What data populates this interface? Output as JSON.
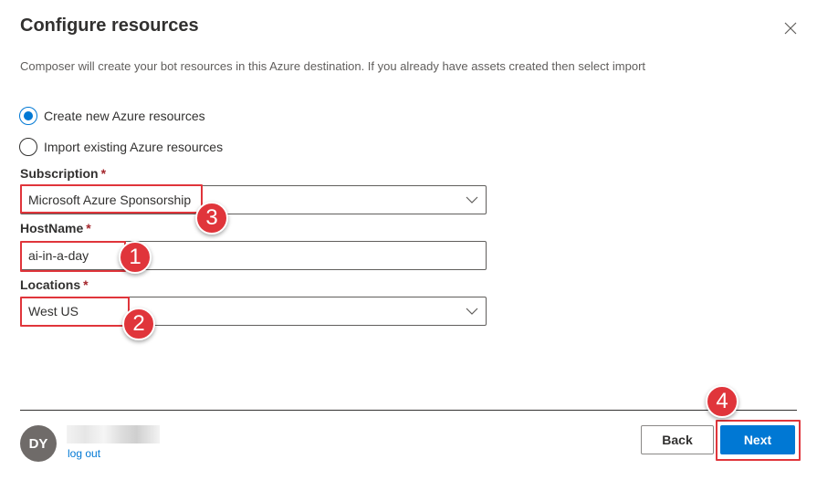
{
  "dialog": {
    "title": "Configure resources",
    "description": "Composer will create your bot resources in this Azure destination. If you already have assets created then select import"
  },
  "options": {
    "create_new": "Create new Azure resources",
    "import_existing": "Import existing Azure resources",
    "selected": "create_new"
  },
  "subscription": {
    "label": "Subscription",
    "required_mark": "*",
    "value": "Microsoft Azure Sponsorship"
  },
  "hostname": {
    "label": "HostName",
    "required_mark": "*",
    "value": "ai-in-a-day"
  },
  "locations": {
    "label": "Locations",
    "required_mark": "*",
    "value": "West US"
  },
  "annotations": {
    "badge_1": "1",
    "badge_2": "2",
    "badge_3": "3",
    "badge_4": "4",
    "color": "#e0353b"
  },
  "footer": {
    "avatar_initials": "DY",
    "logout": "log out",
    "back": "Back",
    "next": "Next"
  },
  "colors": {
    "primary": "#0078d4",
    "required": "#a4262c",
    "text": "#323130"
  }
}
